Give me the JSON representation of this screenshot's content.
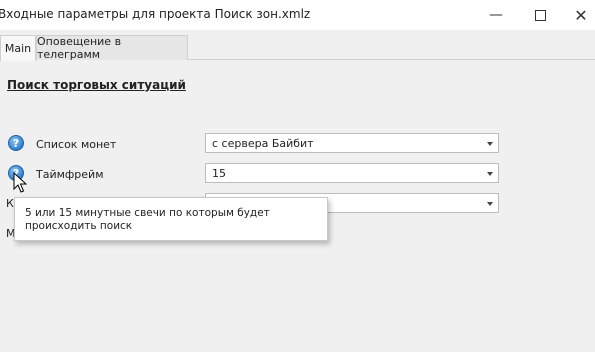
{
  "window": {
    "title": "Входные параметры для проекта Поиск зон.xmlz",
    "minimize_icon": "minimize-icon",
    "maximize_icon": "maximize-icon",
    "close_icon": "close-icon"
  },
  "tabs": [
    {
      "label": "Main",
      "active": true
    },
    {
      "label": "Оповещение в телеграмм",
      "active": false
    }
  ],
  "section": {
    "title": "Поиск торговых ситуаций"
  },
  "fields": [
    {
      "label": "Список монет",
      "value": "с сервера Байбит",
      "icon": "help-icon"
    },
    {
      "label": "Таймфрейм",
      "value": "15",
      "icon": "help-icon"
    },
    {
      "label": "К",
      "value": ""
    },
    {
      "label": "М"
    }
  ],
  "tooltip": {
    "text": "5 или 15 минутные свечи по которым будет происходить поиск"
  },
  "colors": {
    "help_icon": "#2f7fd0",
    "background": "#f0f0f0"
  }
}
